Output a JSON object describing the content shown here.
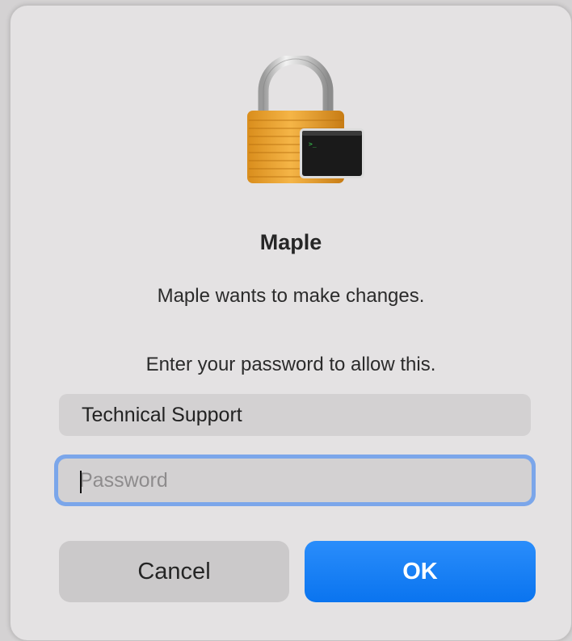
{
  "dialog": {
    "icon": "lock-icon",
    "title": "Maple",
    "message": "Maple wants to make changes.",
    "prompt": "Enter your password to allow this.",
    "username": "Technical Support",
    "password": {
      "value": "",
      "placeholder": "Password"
    },
    "buttons": {
      "cancel_label": "Cancel",
      "ok_label": "OK"
    }
  },
  "colors": {
    "accent": "#0a74ef",
    "focus_ring": "#7ba6ea",
    "dialog_bg": "#e4e2e3"
  }
}
